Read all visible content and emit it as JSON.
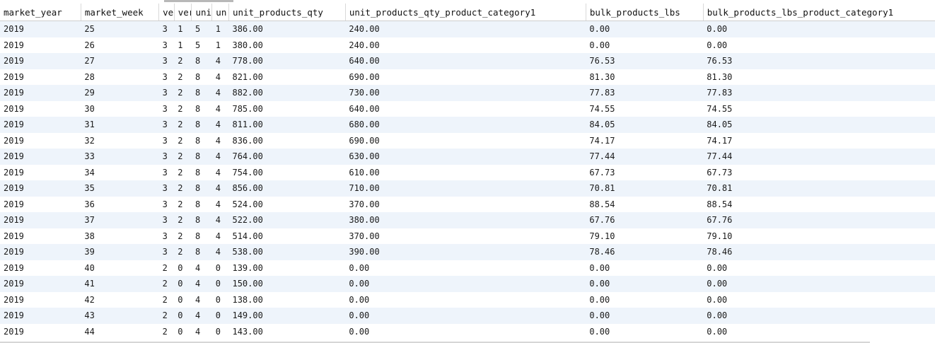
{
  "columns": [
    "market_year",
    "market_week",
    "ver",
    "ver",
    "uni",
    "un",
    "unit_products_qty",
    "unit_products_qty_product_category1",
    "bulk_products_lbs",
    "bulk_products_lbs_product_category1"
  ],
  "rows": [
    [
      "2019",
      "25",
      "3",
      "1",
      "5",
      "1",
      "386.00",
      "240.00",
      "0.00",
      "0.00"
    ],
    [
      "2019",
      "26",
      "3",
      "1",
      "5",
      "1",
      "380.00",
      "240.00",
      "0.00",
      "0.00"
    ],
    [
      "2019",
      "27",
      "3",
      "2",
      "8",
      "4",
      "778.00",
      "640.00",
      "76.53",
      "76.53"
    ],
    [
      "2019",
      "28",
      "3",
      "2",
      "8",
      "4",
      "821.00",
      "690.00",
      "81.30",
      "81.30"
    ],
    [
      "2019",
      "29",
      "3",
      "2",
      "8",
      "4",
      "882.00",
      "730.00",
      "77.83",
      "77.83"
    ],
    [
      "2019",
      "30",
      "3",
      "2",
      "8",
      "4",
      "785.00",
      "640.00",
      "74.55",
      "74.55"
    ],
    [
      "2019",
      "31",
      "3",
      "2",
      "8",
      "4",
      "811.00",
      "680.00",
      "84.05",
      "84.05"
    ],
    [
      "2019",
      "32",
      "3",
      "2",
      "8",
      "4",
      "836.00",
      "690.00",
      "74.17",
      "74.17"
    ],
    [
      "2019",
      "33",
      "3",
      "2",
      "8",
      "4",
      "764.00",
      "630.00",
      "77.44",
      "77.44"
    ],
    [
      "2019",
      "34",
      "3",
      "2",
      "8",
      "4",
      "754.00",
      "610.00",
      "67.73",
      "67.73"
    ],
    [
      "2019",
      "35",
      "3",
      "2",
      "8",
      "4",
      "856.00",
      "710.00",
      "70.81",
      "70.81"
    ],
    [
      "2019",
      "36",
      "3",
      "2",
      "8",
      "4",
      "524.00",
      "370.00",
      "88.54",
      "88.54"
    ],
    [
      "2019",
      "37",
      "3",
      "2",
      "8",
      "4",
      "522.00",
      "380.00",
      "67.76",
      "67.76"
    ],
    [
      "2019",
      "38",
      "3",
      "2",
      "8",
      "4",
      "514.00",
      "370.00",
      "79.10",
      "79.10"
    ],
    [
      "2019",
      "39",
      "3",
      "2",
      "8",
      "4",
      "538.00",
      "390.00",
      "78.46",
      "78.46"
    ],
    [
      "2019",
      "40",
      "2",
      "0",
      "4",
      "0",
      "139.00",
      "0.00",
      "0.00",
      "0.00"
    ],
    [
      "2019",
      "41",
      "2",
      "0",
      "4",
      "0",
      "150.00",
      "0.00",
      "0.00",
      "0.00"
    ],
    [
      "2019",
      "42",
      "2",
      "0",
      "4",
      "0",
      "138.00",
      "0.00",
      "0.00",
      "0.00"
    ],
    [
      "2019",
      "43",
      "2",
      "0",
      "4",
      "0",
      "149.00",
      "0.00",
      "0.00",
      "0.00"
    ],
    [
      "2019",
      "44",
      "2",
      "0",
      "4",
      "0",
      "143.00",
      "0.00",
      "0.00",
      "0.00"
    ]
  ],
  "colors": {
    "alt_row": "#eef4fb",
    "header_border": "#d9d9d9"
  }
}
